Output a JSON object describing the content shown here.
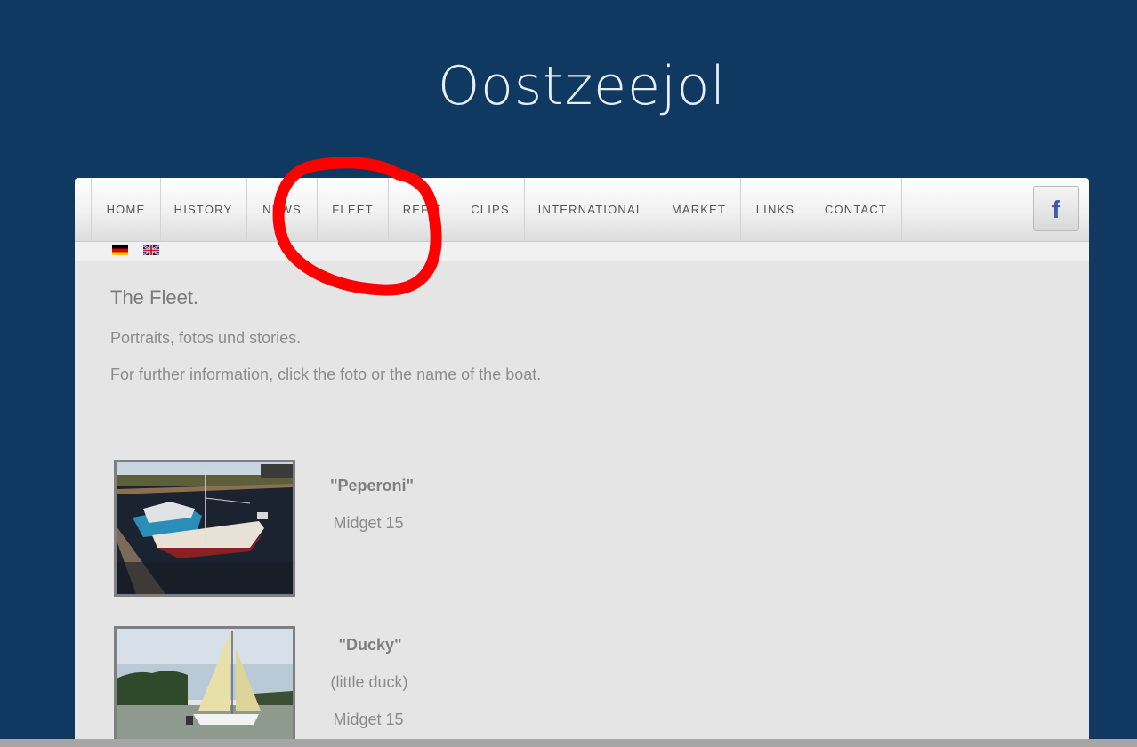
{
  "site": {
    "title": "Oostzeejol"
  },
  "nav": {
    "items": [
      {
        "label": "HOME"
      },
      {
        "label": "HISTORY"
      },
      {
        "label": "NEWS"
      },
      {
        "label": "FLEET"
      },
      {
        "label": "REFIT"
      },
      {
        "label": "CLIPS"
      },
      {
        "label": "INTERNATIONAL"
      },
      {
        "label": "MARKET"
      },
      {
        "label": "LINKS"
      },
      {
        "label": "CONTACT"
      }
    ],
    "facebook_label": "f"
  },
  "languages": [
    {
      "icon": "flag-germany-icon"
    },
    {
      "icon": "flag-uk-icon"
    }
  ],
  "page": {
    "heading": "The Fleet.",
    "intro": "Portraits, fotos und stories.",
    "instruction": "For further information, click the foto or the name of the boat."
  },
  "boats": [
    {
      "name": "\"Peperoni\"",
      "type": "Midget 15"
    },
    {
      "name": "\"Ducky\"",
      "subtitle": "(little duck)",
      "type": "Midget 15"
    }
  ],
  "colors": {
    "header_bg": "#0f3960",
    "content_bg": "#e5e5e5",
    "annotation_red": "#ff0000",
    "facebook_blue": "#3b5ab0"
  }
}
